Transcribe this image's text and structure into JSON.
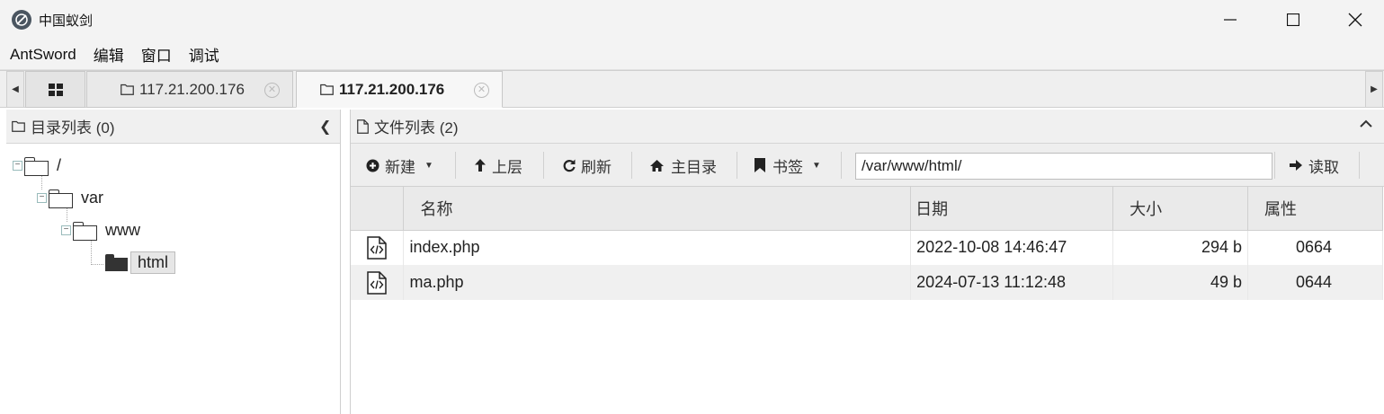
{
  "window": {
    "title": "中国蚁剑"
  },
  "menu": [
    "AntSword",
    "编辑",
    "窗口",
    "调试"
  ],
  "tabs": [
    {
      "label": "117.21.200.176"
    },
    {
      "label": "117.21.200.176"
    }
  ],
  "left_panel": {
    "title": "目录列表 (0)",
    "tree": [
      "/",
      "var",
      "www",
      "html"
    ]
  },
  "right_panel": {
    "title": "文件列表 (2)",
    "toolbar": {
      "new": "新建",
      "up": "上层",
      "refresh": "刷新",
      "home": "主目录",
      "bookmark": "书签",
      "path": "/var/www/html/",
      "read": "读取"
    },
    "columns": {
      "name": "名称",
      "date": "日期",
      "size": "大小",
      "attr": "属性"
    },
    "files": [
      {
        "name": "index.php",
        "date": "2022-10-08 14:46:47",
        "size": "294 b",
        "attr": "0664"
      },
      {
        "name": "ma.php",
        "date": "2024-07-13 11:12:48",
        "size": "49 b",
        "attr": "0644"
      }
    ]
  }
}
